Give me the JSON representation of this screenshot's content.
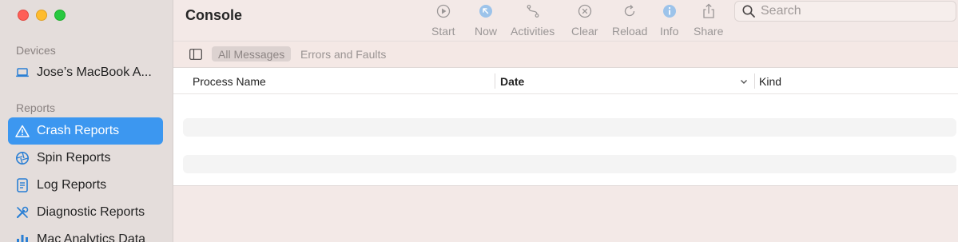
{
  "window": {
    "title": "Console"
  },
  "sidebar": {
    "devices_label": "Devices",
    "device": {
      "label": "Jose’s MacBook A...",
      "icon": "laptop-icon"
    },
    "reports_label": "Reports",
    "items": [
      {
        "label": "Crash Reports",
        "icon": "warning-triangle-icon",
        "active": true
      },
      {
        "label": "Spin Reports",
        "icon": "spin-aperture-icon",
        "active": false
      },
      {
        "label": "Log Reports",
        "icon": "document-icon",
        "active": false
      },
      {
        "label": "Diagnostic Reports",
        "icon": "tools-icon",
        "active": false
      },
      {
        "label": "Mac Analytics Data",
        "icon": "bar-chart-icon",
        "active": false
      }
    ]
  },
  "toolbar": {
    "start": "Start",
    "now": "Now",
    "activities": "Activities",
    "clear": "Clear",
    "reload": "Reload",
    "info": "Info",
    "share": "Share"
  },
  "search": {
    "placeholder": "Search"
  },
  "filters": {
    "all_messages": "All Messages",
    "errors_faults": "Errors and Faults"
  },
  "table": {
    "columns": [
      "Process Name",
      "Date",
      "Kind"
    ],
    "sorted_column": "Date"
  },
  "colors": {
    "accent": "#3c97f0",
    "sidebar_bg": "#e4dddb",
    "window_bg": "#f3e9e7"
  }
}
